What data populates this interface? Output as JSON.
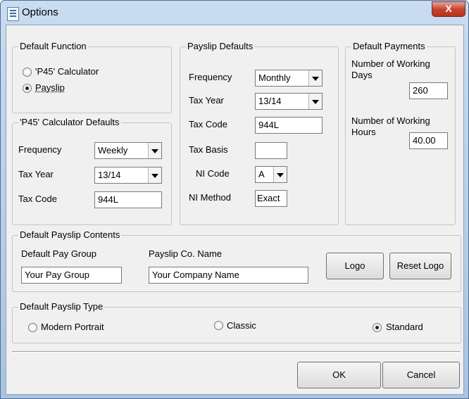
{
  "window": {
    "title": "Options",
    "close_glyph": "X"
  },
  "default_function": {
    "legend": "Default Function",
    "options": [
      {
        "label": "'P45' Calculator",
        "checked": false
      },
      {
        "label": "Payslip",
        "checked": true
      }
    ]
  },
  "p45_defaults": {
    "legend": "'P45' Calculator Defaults",
    "frequency_label": "Frequency",
    "frequency_value": "Weekly",
    "tax_year_label": "Tax Year",
    "tax_year_value": "13/14",
    "tax_code_label": "Tax Code",
    "tax_code_value": "944L"
  },
  "payslip_defaults": {
    "legend": "Payslip Defaults",
    "frequency_label": "Frequency",
    "frequency_value": "Monthly",
    "tax_year_label": "Tax Year",
    "tax_year_value": "13/14",
    "tax_code_label": "Tax Code",
    "tax_code_value": "944L",
    "tax_basis_label": "Tax Basis",
    "tax_basis_value": "",
    "ni_code_label": "NI Code",
    "ni_code_value": "A",
    "ni_method_label": "NI Method",
    "ni_method_value": "Exact"
  },
  "default_payments": {
    "legend": "Default Payments",
    "working_days_label_1": "Number of Working",
    "working_days_label_2": "Days",
    "working_days_value": "260",
    "working_hours_label_1": "Number of Working",
    "working_hours_label_2": "Hours",
    "working_hours_value": "40.00"
  },
  "payslip_contents": {
    "legend": "Default Payslip Contents",
    "pay_group_label": "Default Pay Group",
    "pay_group_value": "Your Pay Group",
    "co_name_label": "Payslip Co. Name",
    "co_name_value": "Your Company Name",
    "logo_button": "Logo",
    "reset_logo_button": "Reset Logo"
  },
  "payslip_type": {
    "legend": "Default Payslip Type",
    "options": [
      {
        "label": "Modern Portrait",
        "checked": false
      },
      {
        "label": "Classic",
        "checked": false
      },
      {
        "label": "Standard",
        "checked": true
      }
    ]
  },
  "footer": {
    "ok_button": "OK",
    "cancel_button": "Cancel"
  }
}
